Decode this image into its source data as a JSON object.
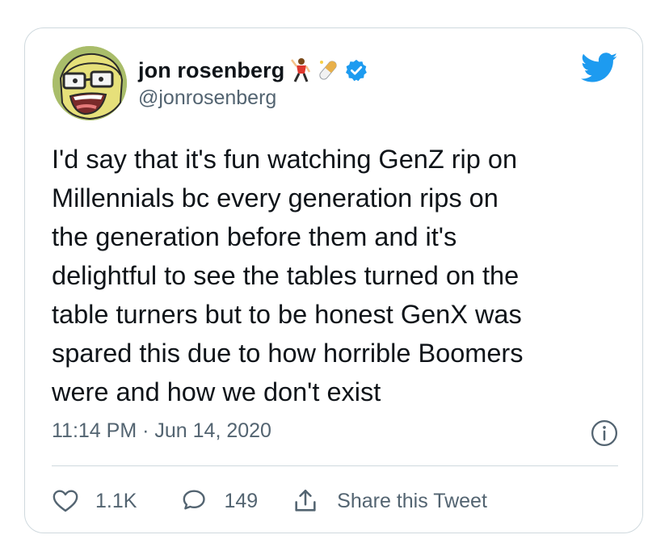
{
  "author": {
    "display_name": "jon rosenberg",
    "emojis": [
      "man-dancing-emoji",
      "pill-emoji"
    ],
    "verified": true,
    "handle": "@jonrosenberg",
    "avatar_icon": "cartoon-avatar"
  },
  "tweet": {
    "text": "I'd say that it's fun watching GenZ rip on\nMillennials bc every generation rips on\nthe generation before them and it's\ndelightful to see the tables turned on the\ntable turners but to be honest GenX was\nspared this due to how horrible Boomers\nwere and how we don't exist",
    "time": "11:14 PM",
    "separator": "·",
    "date": "Jun 14, 2020"
  },
  "actions": {
    "likes": "1.1K",
    "replies": "149",
    "share_label": "Share this Tweet"
  },
  "colors": {
    "brand": "#1d9bf0",
    "text": "#0f1419",
    "secondary": "#536471",
    "border": "#cfd9de"
  }
}
